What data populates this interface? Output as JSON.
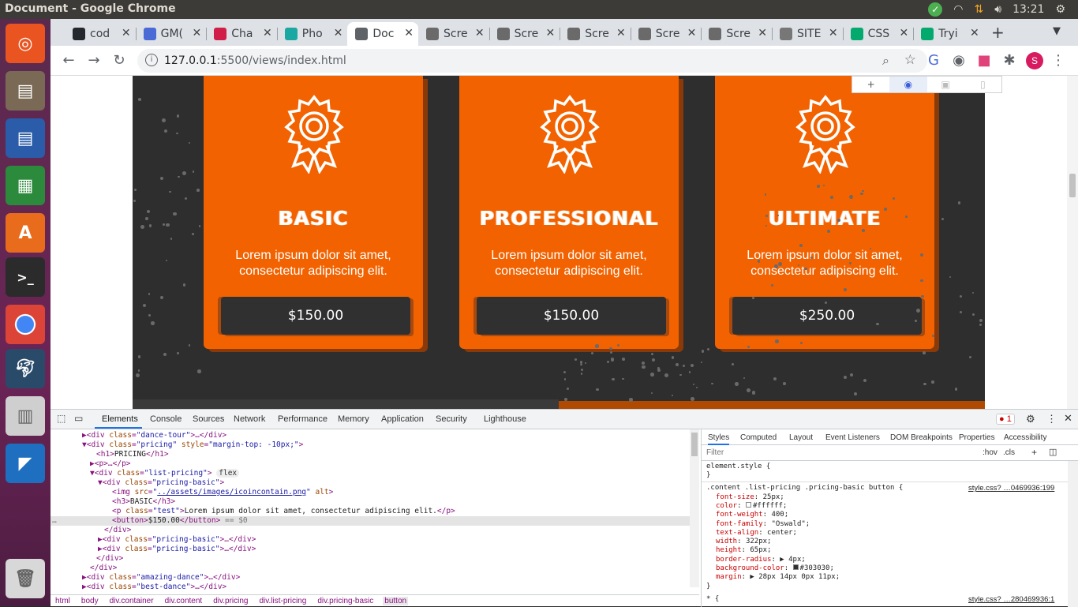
{
  "os": {
    "window_title": "Document - Google Chrome",
    "clock": "13:21",
    "launcher": [
      "ubuntu-icon",
      "files-icon",
      "writer-icon",
      "calc-icon",
      "software-center-icon",
      "terminal-icon",
      "chrome-icon",
      "mysql-workbench-icon",
      "database-icon",
      "vscode-icon",
      "trash-icon"
    ]
  },
  "tabs": [
    {
      "label": "cod",
      "color": "#24292e"
    },
    {
      "label": "GM(",
      "color": "#4a6bd6"
    },
    {
      "label": "Cha",
      "color": "#d01e49"
    },
    {
      "label": "Pho",
      "color": "#1ba7a2"
    },
    {
      "label": "Doc",
      "color": "#5f6368",
      "active": true
    },
    {
      "label": "Scre",
      "color": "#6a6a6a"
    },
    {
      "label": "Scre",
      "color": "#6a6a6a"
    },
    {
      "label": "Scre",
      "color": "#6a6a6a"
    },
    {
      "label": "Scre",
      "color": "#6a6a6a"
    },
    {
      "label": "Scre",
      "color": "#6a6a6a"
    },
    {
      "label": "SITE",
      "color": "#777"
    },
    {
      "label": "CSS",
      "color": "#04aa6d"
    },
    {
      "label": "Tryi",
      "color": "#04aa6d"
    }
  ],
  "toolbar": {
    "url_host": "127.0.0.1",
    "url_rest": ":5500/views/index.html",
    "profile_initial": "S"
  },
  "page": {
    "cards": [
      {
        "title": "BASIC",
        "text": "Lorem ipsum dolor sit amet, consectetur adipiscing elit.",
        "price": "$150.00"
      },
      {
        "title": "PROFESSIONAL",
        "text": "Lorem ipsum dolor sit amet, consectetur adipiscing elit.",
        "price": "$150.00"
      },
      {
        "title": "ULTIMATE",
        "text": "Lorem ipsum dolor sit amet, consectetur adipiscing elit.",
        "price": "$250.00"
      }
    ]
  },
  "devtools": {
    "tabs": [
      "Elements",
      "Console",
      "Sources",
      "Network",
      "Performance",
      "Memory",
      "Application",
      "Security",
      "Lighthouse"
    ],
    "error_count": "1",
    "dom_lines": [
      {
        "indent": 40,
        "html": "▶<span class='tg'>&lt;div</span> <span class='at'>class</span>=<span class='av'>\"dance-tour\"</span><span class='tg'>&gt;</span>…<span class='tg'>&lt;/div&gt;</span>"
      },
      {
        "indent": 40,
        "html": "▼<span class='tg'>&lt;div</span> <span class='at'>class</span>=<span class='av'>\"pricing\"</span> <span class='at'>style</span>=<span class='av'>\"margin-top: -10px;\"</span><span class='tg'>&gt;</span>"
      },
      {
        "indent": 58,
        "html": "<span class='tg'>&lt;h1&gt;</span><span class='tx'>PRICING</span><span class='tg'>&lt;/h1&gt;</span>"
      },
      {
        "indent": 50,
        "html": "▶<span class='tg'>&lt;p&gt;</span>…<span class='tg'>&lt;/p&gt;</span>"
      },
      {
        "indent": 50,
        "html": "▼<span class='tg'>&lt;div</span> <span class='at'>class</span>=<span class='av'>\"list-pricing\"</span><span class='tg'>&gt;</span> <span style='background:#eee;border-radius:6px;color:#333;padding:0 3px'>flex</span>"
      },
      {
        "indent": 60,
        "html": "▼<span class='tg'>&lt;div</span> <span class='at'>class</span>=<span class='av'>\"pricing-basic\"</span><span class='tg'>&gt;</span>"
      },
      {
        "indent": 78,
        "html": "<span class='tg'>&lt;img</span> <span class='at'>src</span>=<span class='av'>\"<span class='lk'>../assets/images/icoincontain.png</span>\"</span> <span class='at'>alt</span><span class='tg'>&gt;</span>"
      },
      {
        "indent": 78,
        "html": "<span class='tg'>&lt;h3&gt;</span><span class='tx'>BASIC</span><span class='tg'>&lt;/h3&gt;</span>"
      },
      {
        "indent": 78,
        "html": "<span class='tg'>&lt;p</span> <span class='at'>class</span>=<span class='av'>\"test\"</span><span class='tg'>&gt;</span><span class='tx'>Lorem ipsum dolor sit amet, consectetur adipiscing elit.</span><span class='tg'>&lt;/p&gt;</span>"
      },
      {
        "indent": 78,
        "hl": true,
        "html": "<span class='tg'>&lt;button&gt;</span><span class='tx'>$150.00</span><span class='tg'>&lt;/button&gt;</span> <span style='color:#777'>== $0</span>"
      },
      {
        "indent": 68,
        "html": "<span class='tg'>&lt;/div&gt;</span>"
      },
      {
        "indent": 60,
        "html": "▶<span class='tg'>&lt;div</span> <span class='at'>class</span>=<span class='av'>\"pricing-basic\"</span><span class='tg'>&gt;</span>…<span class='tg'>&lt;/div&gt;</span>"
      },
      {
        "indent": 60,
        "html": "▶<span class='tg'>&lt;div</span> <span class='at'>class</span>=<span class='av'>\"pricing-basic\"</span><span class='tg'>&gt;</span>…<span class='tg'>&lt;/div&gt;</span>"
      },
      {
        "indent": 58,
        "html": "<span class='tg'>&lt;/div&gt;</span>"
      },
      {
        "indent": 50,
        "html": "<span class='tg'>&lt;/div&gt;</span>"
      },
      {
        "indent": 40,
        "html": "▶<span class='tg'>&lt;div</span> <span class='at'>class</span>=<span class='av'>\"amazing-dance\"</span><span class='tg'>&gt;</span>…<span class='tg'>&lt;/div&gt;</span>"
      },
      {
        "indent": 40,
        "html": "▶<span class='tg'>&lt;div</span> <span class='at'>class</span>=<span class='av'>\"best-dance\"</span><span class='tg'>&gt;</span>…<span class='tg'>&lt;/div&gt;</span>"
      }
    ],
    "breadcrumbs": [
      "html",
      "body",
      "div.container",
      "div.content",
      "div.pricing",
      "div.list-pricing",
      "div.pricing-basic",
      "button"
    ],
    "style_tabs": [
      "Styles",
      "Computed",
      "Layout",
      "Event Listeners",
      "DOM Breakpoints",
      "Properties",
      "Accessibility"
    ],
    "filter_placeholder": "Filter",
    "hov": ":hov",
    "cls": ".cls",
    "rules": [
      {
        "text": "element.style {"
      },
      {
        "text": "}"
      },
      {
        "text": ".content .list-pricing .pricing-basic button {",
        "src": "style.css? …0469936:199"
      },
      {
        "prop": "font-size",
        "val": "25px;"
      },
      {
        "prop": "color",
        "val": "#ffffff;",
        "swatch": "#ffffff"
      },
      {
        "prop": "font-weight",
        "val": "400;"
      },
      {
        "prop": "font-family",
        "val": "\"Oswald\";"
      },
      {
        "prop": "text-align",
        "val": "center;"
      },
      {
        "prop": "width",
        "val": "322px;"
      },
      {
        "prop": "height",
        "val": "65px;"
      },
      {
        "prop": "border-radius",
        "val": "▶ 4px;"
      },
      {
        "prop": "background-color",
        "val": "#303030;",
        "swatch": "#303030"
      },
      {
        "prop": "margin",
        "val": "▶ 28px 14px 0px 11px;"
      },
      {
        "text": "}"
      },
      {
        "text": "* {",
        "src": "style.css? …280469936:1"
      }
    ]
  }
}
